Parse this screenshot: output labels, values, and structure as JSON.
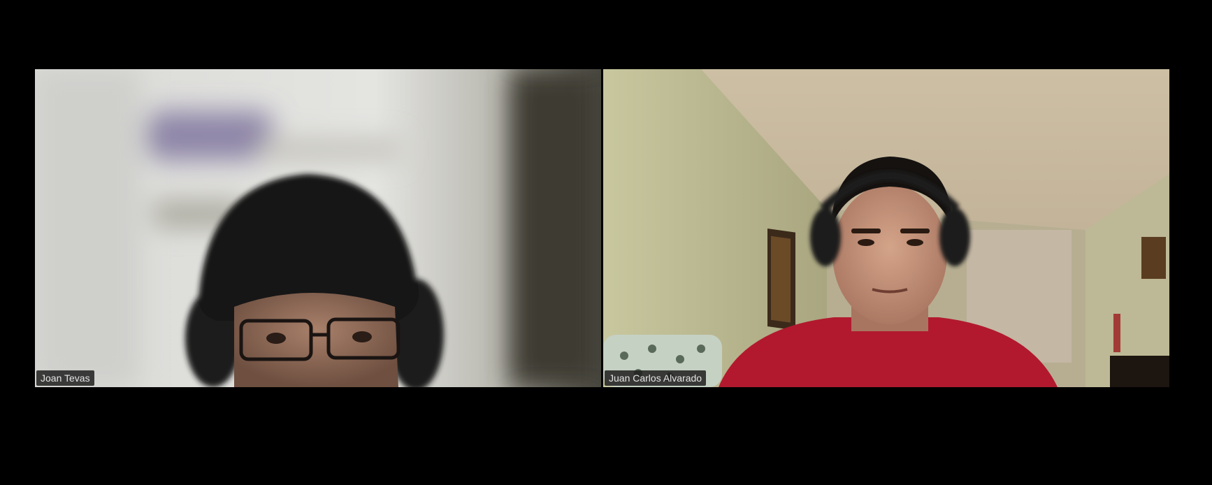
{
  "meeting": {
    "participants": [
      {
        "name": "Joan Tevas",
        "video_icon": "participant-video"
      },
      {
        "name": "Juan Carlos Alvarado",
        "video_icon": "participant-video"
      }
    ]
  },
  "colors": {
    "background": "#000000",
    "label_background": "#1e1e1e",
    "label_text": "#e6e6e6"
  }
}
